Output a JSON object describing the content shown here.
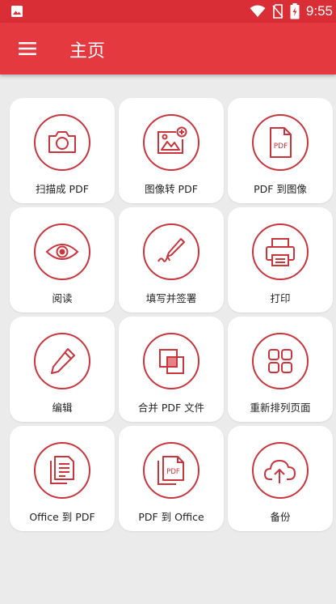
{
  "status_bar": {
    "time": "9:55",
    "icons": [
      "image-notification-icon",
      "wifi-icon",
      "no-sim-icon",
      "battery-charging-icon"
    ]
  },
  "app_bar": {
    "title": "主页",
    "menu_icon": "hamburger-menu-icon"
  },
  "tiles": [
    {
      "label": "扫描成 PDF",
      "icon": "camera-icon"
    },
    {
      "label": "图像转 PDF",
      "icon": "image-add-icon"
    },
    {
      "label": "PDF 到图像",
      "icon": "pdf-file-icon"
    },
    {
      "label": "阅读",
      "icon": "eye-icon"
    },
    {
      "label": "填写并签署",
      "icon": "signature-pen-icon"
    },
    {
      "label": "打印",
      "icon": "printer-icon"
    },
    {
      "label": "编辑",
      "icon": "pencil-icon"
    },
    {
      "label": "合并 PDF 文件",
      "icon": "merge-squares-icon"
    },
    {
      "label": "重新排列页面",
      "icon": "grid-rearrange-icon"
    },
    {
      "label": "Office 到 PDF",
      "icon": "document-stack-icon"
    },
    {
      "label": "PDF 到 Office",
      "icon": "pdf-stack-icon"
    },
    {
      "label": "备份",
      "icon": "cloud-upload-icon"
    }
  ],
  "colors": {
    "status_bar": "#d92e35",
    "app_bar": "#e53940",
    "accent": "#c9353c",
    "background": "#ebebeb",
    "card": "#ffffff"
  }
}
